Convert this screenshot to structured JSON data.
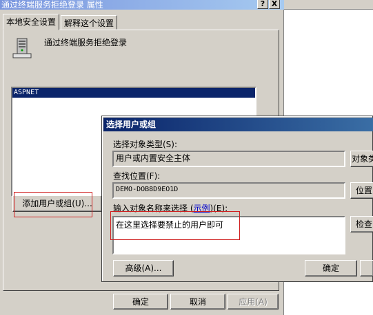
{
  "window": {
    "title": "通过终端服务拒绝登录 属性",
    "help_btn": "?",
    "close_btn": "X",
    "tabs": [
      "本地安全设置",
      "解释这个设置"
    ],
    "policy_name": "通过终端服务拒绝登录",
    "list_items": [
      "ASPNET"
    ],
    "add_button": "添加用户或组(U)...",
    "buttons": {
      "ok": "确定",
      "cancel": "取消",
      "apply": "应用(A)"
    }
  },
  "dialog": {
    "title": "选择用户或组",
    "object_type_label": "选择对象类型(S):",
    "object_type_value": "用户或内置安全主体",
    "object_type_button": "对象类",
    "location_label": "查找位置(F):",
    "location_value": "DEMO-DOB8D9EO1D",
    "location_button": "位置",
    "input_label_before": "输入对象名称来选择 (",
    "input_label_link": "示例",
    "input_label_after": ")(E):",
    "input_value": "在这里选择要禁止的用户即可",
    "check_button": "检查",
    "advanced_button": "高级(A)...",
    "ok_button": "确定"
  }
}
